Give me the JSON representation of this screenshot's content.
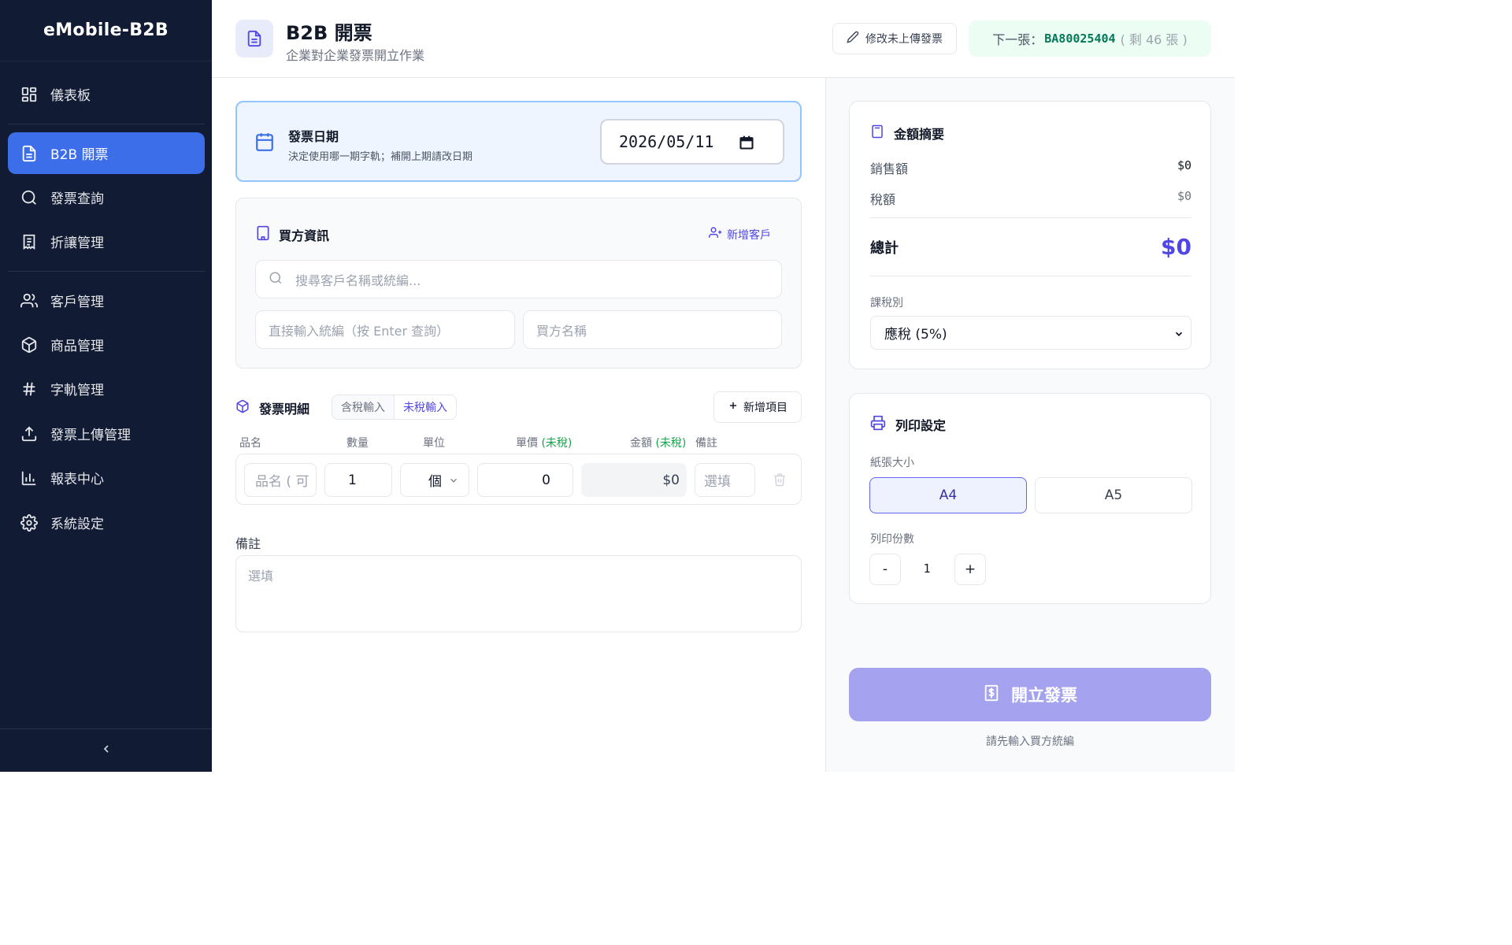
{
  "app": {
    "brand": "eMobile-B2B"
  },
  "sidebar": {
    "items": [
      {
        "label": "儀表板",
        "icon": "dashboard-icon"
      },
      {
        "label": "B2B 開票",
        "icon": "file-text-icon",
        "active": true
      },
      {
        "label": "發票查詢",
        "icon": "search-icon"
      },
      {
        "label": "折讓管理",
        "icon": "receipt-icon"
      },
      {
        "label": "客戶管理",
        "icon": "users-icon"
      },
      {
        "label": "商品管理",
        "icon": "box-icon"
      },
      {
        "label": "字軌管理",
        "icon": "hash-icon"
      },
      {
        "label": "發票上傳管理",
        "icon": "upload-icon"
      },
      {
        "label": "報表中心",
        "icon": "bar-chart-icon"
      },
      {
        "label": "系統設定",
        "icon": "gear-icon"
      }
    ],
    "collapse_icon": "chevron-left-icon"
  },
  "header": {
    "title": "B2B 開票",
    "subtitle": "企業對企業發票開立作業",
    "edit_button": "修改未上傳發票",
    "next_label": "下一張：",
    "next_number": "BA80025404",
    "remaining": "( 剩 46 張 )"
  },
  "date_card": {
    "title": "發票日期",
    "desc": "決定使用哪一期字軌；補開上期請改日期",
    "value": "2026/05/11"
  },
  "buyer": {
    "title": "買方資訊",
    "add_customer": "新增客戶",
    "search_placeholder": "搜尋客戶名稱或統編...",
    "tax_id_placeholder": "直接輸入統編（按 Enter 查詢）",
    "name_placeholder": "買方名稱"
  },
  "items": {
    "title": "發票明細",
    "toggle_tax_incl": "含稅輸入",
    "toggle_tax_excl": "未稅輸入",
    "add_item": "新增項目",
    "headers": {
      "name": "品名",
      "qty": "數量",
      "unit": "單位",
      "price": "單價",
      "price_note": "(未稅)",
      "amount": "金額",
      "amount_note": "(未稅)",
      "remark": "備註"
    },
    "row": {
      "name_placeholder": "品名 ( 可",
      "qty": "1",
      "unit": "個",
      "price": "0",
      "amount": "$0",
      "remark_placeholder": "選填"
    }
  },
  "remark": {
    "label": "備註",
    "placeholder": "選填"
  },
  "summary": {
    "title": "金額摘要",
    "sales_label": "銷售額",
    "sales_value": "$0",
    "tax_label": "稅額",
    "tax_value": "$0",
    "total_label": "總計",
    "total_value": "$0",
    "tax_type_label": "課稅別",
    "tax_type_value": "應稅 (5%)"
  },
  "print": {
    "title": "列印設定",
    "paper_label": "紙張大小",
    "paper_a4": "A4",
    "paper_a5": "A5",
    "copies_label": "列印份數",
    "minus": "-",
    "plus": "+",
    "copies": "1"
  },
  "action": {
    "issue_button": "開立發票",
    "hint": "請先輸入買方統編"
  },
  "colors": {
    "sidebar_bg": "#111b33",
    "active_nav": "#3b6ee8",
    "accent": "#4f46e5",
    "issue_button": "#a5a2f0",
    "next_number": "#047857"
  }
}
